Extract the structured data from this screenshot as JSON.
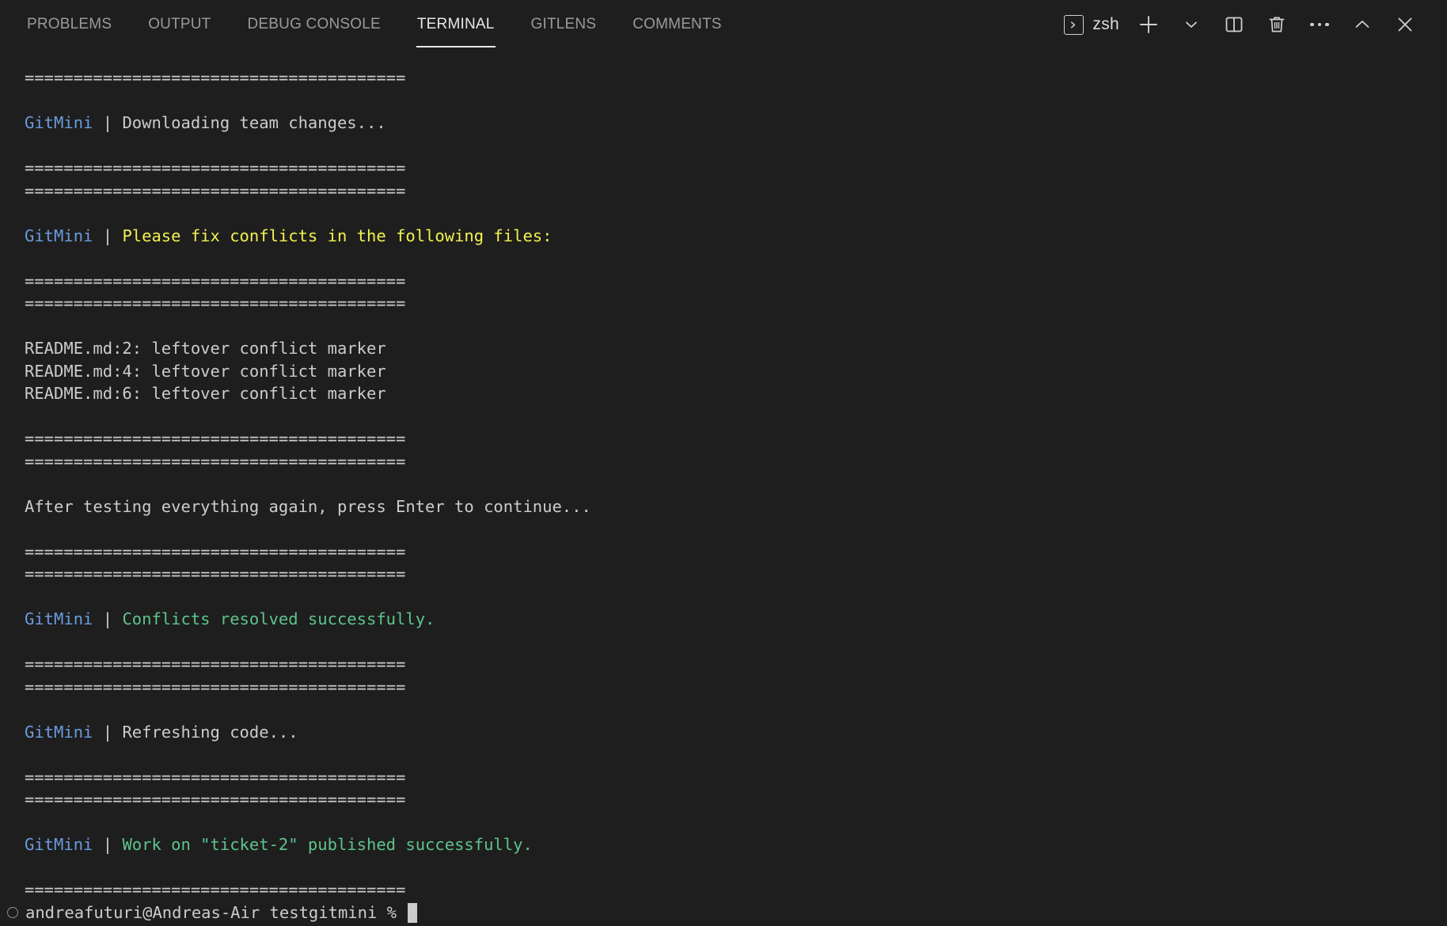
{
  "panel": {
    "tabs": [
      {
        "label": "PROBLEMS",
        "active": false
      },
      {
        "label": "OUTPUT",
        "active": false
      },
      {
        "label": "DEBUG CONSOLE",
        "active": false
      },
      {
        "label": "TERMINAL",
        "active": true
      },
      {
        "label": "GITLENS",
        "active": false
      },
      {
        "label": "COMMENTS",
        "active": false
      }
    ],
    "actions": {
      "shell_label": "zsh",
      "shell_icon": "terminal-icon",
      "new_terminal_icon": "plus-icon",
      "new_terminal_dropdown_icon": "chevron-down-icon",
      "split_terminal_icon": "split-panel-icon",
      "kill_terminal_icon": "trash-icon",
      "more_actions_icon": "ellipsis-icon",
      "maximize_panel_icon": "chevron-up-icon",
      "close_panel_icon": "close-icon"
    }
  },
  "colors": {
    "background": "#1e1e1e",
    "foreground": "#cccccc",
    "blue": "#6a9bdd",
    "yellow": "#f2f24f",
    "green": "#5ec48b",
    "tab_inactive": "#9a9a9a",
    "tab_active": "#e7e7e7"
  },
  "terminal": {
    "separator": "=======================================",
    "lines": [
      {
        "type": "sep"
      },
      {
        "type": "blank"
      },
      {
        "type": "tagged",
        "tag": "GitMini",
        "pipe": " | ",
        "message": "Downloading team changes...",
        "color": "white"
      },
      {
        "type": "blank"
      },
      {
        "type": "sep"
      },
      {
        "type": "sep"
      },
      {
        "type": "blank"
      },
      {
        "type": "tagged",
        "tag": "GitMini",
        "pipe": " | ",
        "message": "Please fix conflicts in the following files:",
        "color": "yellow"
      },
      {
        "type": "blank"
      },
      {
        "type": "sep"
      },
      {
        "type": "sep"
      },
      {
        "type": "blank"
      },
      {
        "type": "plain",
        "message": "README.md:2: leftover conflict marker",
        "color": "white"
      },
      {
        "type": "plain",
        "message": "README.md:4: leftover conflict marker",
        "color": "white"
      },
      {
        "type": "plain",
        "message": "README.md:6: leftover conflict marker",
        "color": "white"
      },
      {
        "type": "blank"
      },
      {
        "type": "sep"
      },
      {
        "type": "sep"
      },
      {
        "type": "blank"
      },
      {
        "type": "plain",
        "message": "After testing everything again, press Enter to continue...",
        "color": "white"
      },
      {
        "type": "blank"
      },
      {
        "type": "sep"
      },
      {
        "type": "sep"
      },
      {
        "type": "blank"
      },
      {
        "type": "tagged",
        "tag": "GitMini",
        "pipe": " | ",
        "message": "Conflicts resolved successfully.",
        "color": "green"
      },
      {
        "type": "blank"
      },
      {
        "type": "sep"
      },
      {
        "type": "sep"
      },
      {
        "type": "blank"
      },
      {
        "type": "tagged",
        "tag": "GitMini",
        "pipe": " | ",
        "message": "Refreshing code...",
        "color": "white"
      },
      {
        "type": "blank"
      },
      {
        "type": "sep"
      },
      {
        "type": "sep"
      },
      {
        "type": "blank"
      },
      {
        "type": "tagged",
        "tag": "GitMini",
        "pipe": " | ",
        "message": "Work on \"ticket-2\" published successfully.",
        "color": "green"
      },
      {
        "type": "blank"
      },
      {
        "type": "sep"
      }
    ],
    "prompt": {
      "marker": "shell-integration-circle",
      "text": "andreafuturi@Andreas-Air testgitmini % "
    }
  }
}
